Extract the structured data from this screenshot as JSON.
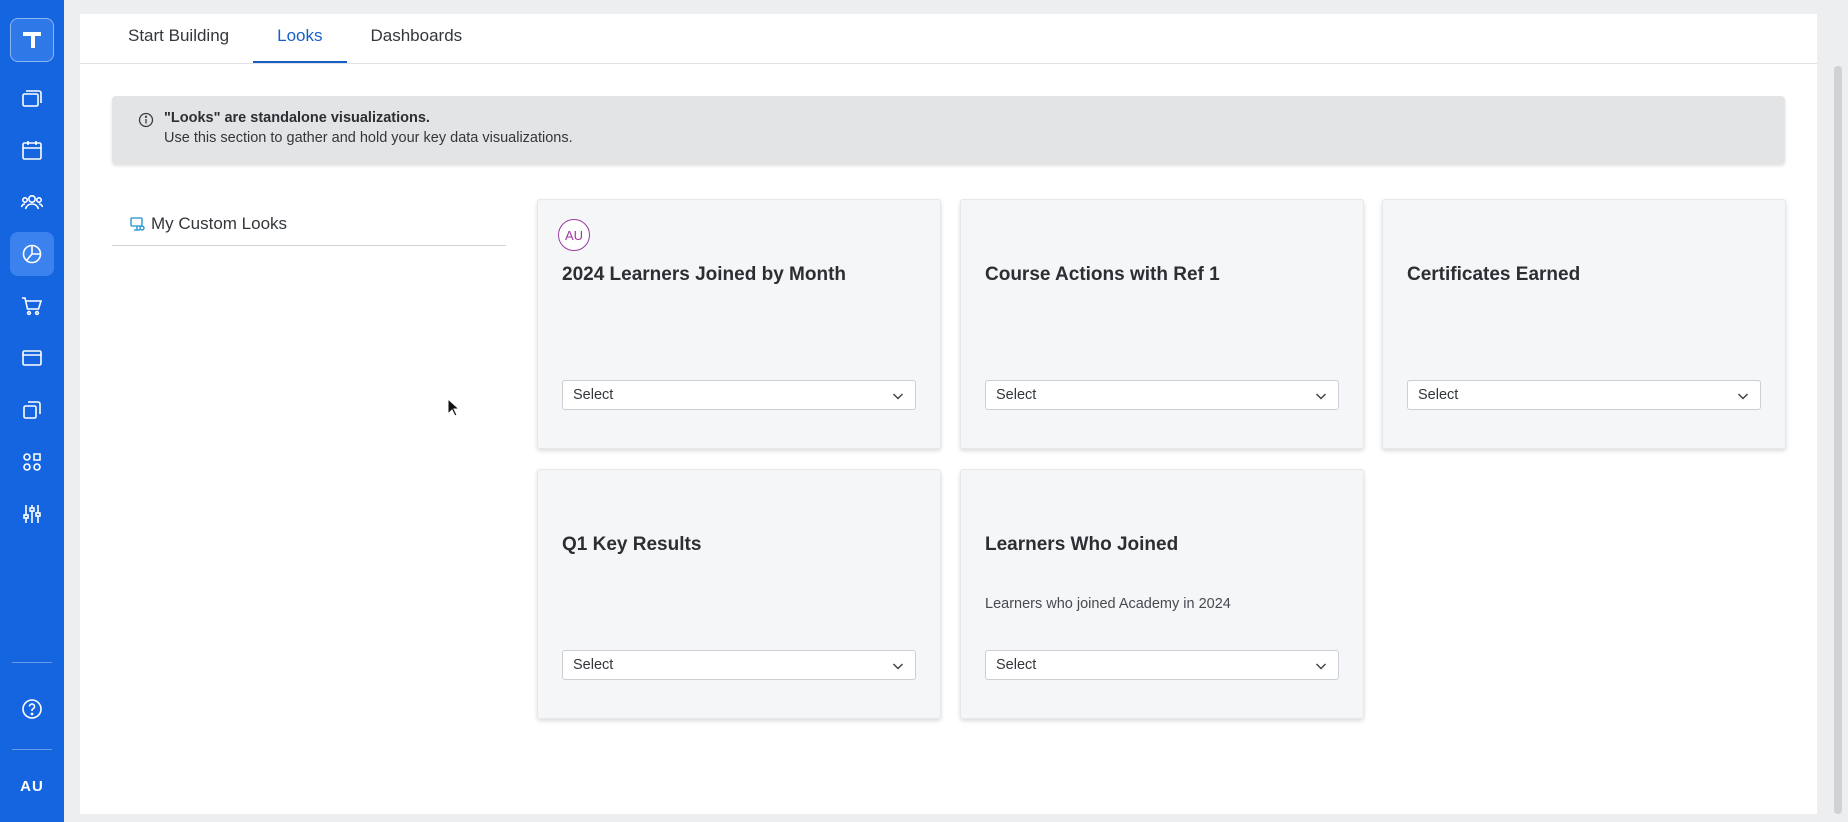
{
  "rail": {
    "nav_icons": [
      "cards-icon",
      "calendar-icon",
      "users-icon",
      "chart-icon",
      "cart-icon",
      "window-icon",
      "copy-icon",
      "apps-icon",
      "sliders-icon"
    ],
    "active_index": 3,
    "help_icon": "help-icon",
    "user_initials": "AU",
    "color": "#1565e0"
  },
  "tabs": [
    {
      "label": "Start Building",
      "active": false
    },
    {
      "label": "Looks",
      "active": true
    },
    {
      "label": "Dashboards",
      "active": false
    }
  ],
  "info": {
    "title": "\"Looks\" are standalone visualizations.",
    "body": "Use this section to gather and hold your key data visualizations."
  },
  "sidebar": {
    "title": "My Custom Looks"
  },
  "cards": [
    {
      "avatar": "AU",
      "title": "2024 Learners Joined by Month",
      "description": "",
      "select": "Select"
    },
    {
      "avatar": "",
      "title": "Course Actions with Ref 1",
      "description": "",
      "select": "Select"
    },
    {
      "avatar": "",
      "title": "Certificates Earned",
      "description": "",
      "select": "Select"
    },
    {
      "avatar": "",
      "title": "Q1 Key Results",
      "description": "",
      "select": "Select"
    },
    {
      "avatar": "",
      "title": "Learners Who Joined",
      "description": "Learners who joined Academy in 2024",
      "select": "Select"
    }
  ]
}
